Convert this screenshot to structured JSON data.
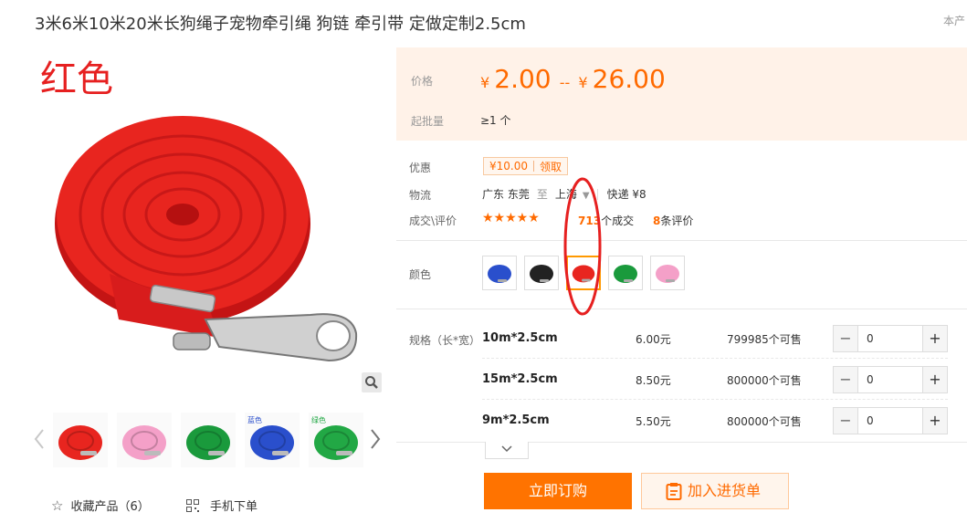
{
  "product": {
    "title": "3米6米10米20米长狗绳子宠物牵引绳 狗链 牵引带 定做定制2.5cm",
    "corner_note": "本产"
  },
  "gallery": {
    "color_caption": "红色",
    "favorite_label": "收藏产品（6）",
    "mobile_label": "手机下单",
    "thumbnails": [
      {
        "name": "red",
        "color": "#e8251f",
        "caption": ""
      },
      {
        "name": "pink",
        "color": "#f4a0c8",
        "caption": ""
      },
      {
        "name": "green",
        "color": "#1a9a3c",
        "caption": ""
      },
      {
        "name": "blue",
        "color": "#2a4fcc",
        "caption": "蓝色"
      },
      {
        "name": "green",
        "color": "#22a845",
        "caption": "绿色"
      }
    ]
  },
  "price": {
    "label": "价格",
    "currency": "¥",
    "low": "2.00",
    "separator": "--",
    "high": "26.00",
    "moq_label": "起批量",
    "moq_value": "≥1 个"
  },
  "promo": {
    "label": "优惠",
    "amount": "¥10.00",
    "action": "领取"
  },
  "logistics": {
    "label": "物流",
    "from": "广东 东莞",
    "to_word": "至",
    "dest": "上海",
    "method": "快递 ¥8"
  },
  "trade": {
    "label": "成交\\评价",
    "stars": "★★★★★",
    "deal_count": "713",
    "deal_suffix": "个成交",
    "review_count": "8",
    "review_suffix": "条评价"
  },
  "colors": {
    "label": "颜色",
    "swatches": [
      {
        "name": "blue",
        "color": "#2a4fcc",
        "selected": false
      },
      {
        "name": "black",
        "color": "#222222",
        "selected": false
      },
      {
        "name": "red",
        "color": "#e8251f",
        "selected": true
      },
      {
        "name": "green",
        "color": "#1a9a3c",
        "selected": false
      },
      {
        "name": "pink",
        "color": "#f4a0c8",
        "selected": false
      }
    ]
  },
  "specs": {
    "label": "规格（长*宽）",
    "rows": [
      {
        "size": "10m*2.5cm",
        "price": "6.00元",
        "stock": "799985个可售",
        "qty": "0"
      },
      {
        "size": "15m*2.5cm",
        "price": "8.50元",
        "stock": "800000个可售",
        "qty": "0"
      },
      {
        "size": "9m*2.5cm",
        "price": "5.50元",
        "stock": "800000个可售",
        "qty": "0"
      }
    ],
    "minus": "−",
    "plus": "+"
  },
  "actions": {
    "buy_label": "立即订购",
    "cart_label": "加入进货单"
  },
  "theme": {
    "accent": "#ff6a00",
    "button": "#ff7300",
    "annotation": "#e62020"
  }
}
